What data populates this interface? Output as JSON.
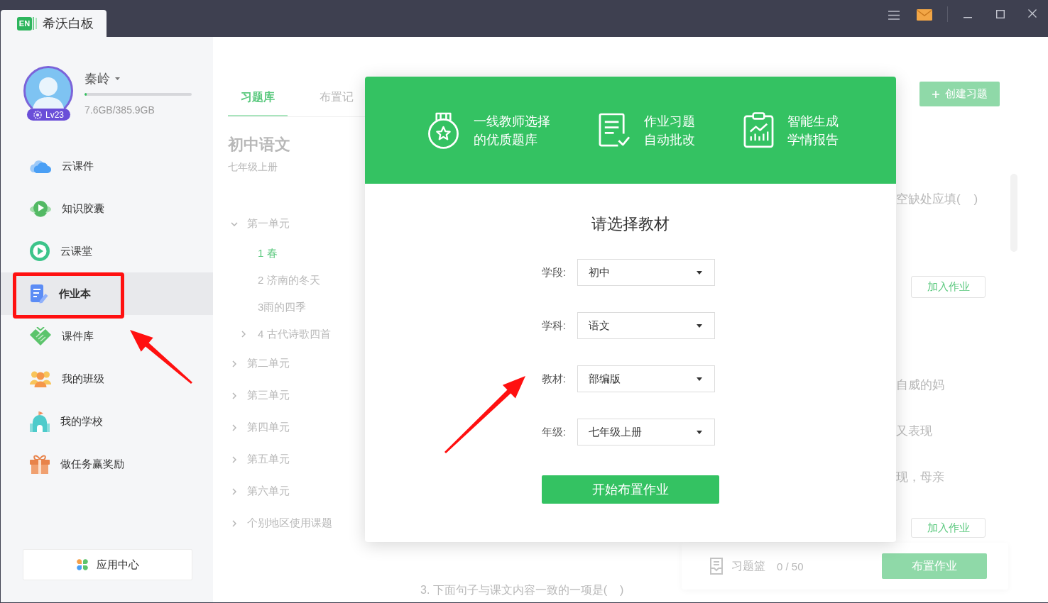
{
  "window": {
    "logo": "EN",
    "app_name": "希沃白板"
  },
  "user": {
    "name": "秦岭",
    "badge": "Lv23",
    "storage_bar": {
      "level": 0.02
    },
    "storage": "7.6GB/385.9GB"
  },
  "sidebar": {
    "items": [
      {
        "label": "云课件",
        "selected": false
      },
      {
        "label": "知识胶囊",
        "selected": false
      },
      {
        "label": "云课堂",
        "selected": false
      },
      {
        "label": "作业本",
        "selected": true
      },
      {
        "label": "课件库",
        "selected": false
      },
      {
        "label": "我的班级",
        "selected": false
      },
      {
        "label": "我的学校",
        "selected": false
      },
      {
        "label": "做任务赢奖励",
        "selected": false
      }
    ],
    "footer_button": "应用中心"
  },
  "library": {
    "tabs": [
      {
        "label": "习题库",
        "selected": true
      },
      {
        "label": "布置记",
        "selected": false
      }
    ],
    "book_title": "初中语文",
    "book_subtitle": "七年级上册",
    "tree": [
      {
        "label": "第一单元",
        "kind": "unit",
        "expanded": true,
        "selected": false,
        "children": [
          {
            "label": "1 春",
            "kind": "lesson",
            "selected": true
          },
          {
            "label": "2 济南的冬天",
            "kind": "lesson",
            "selected": false
          },
          {
            "label": "3雨的四季",
            "kind": "lesson",
            "selected": false
          },
          {
            "label": "4 古代诗歌四首",
            "kind": "lesson",
            "expanded": false,
            "selected": false
          }
        ]
      },
      {
        "label": "第二单元",
        "kind": "unit",
        "expanded": false,
        "selected": false
      },
      {
        "label": "第三单元",
        "kind": "unit",
        "expanded": false,
        "selected": false
      },
      {
        "label": "第四单元",
        "kind": "unit",
        "expanded": false,
        "selected": false
      },
      {
        "label": "第五单元",
        "kind": "unit",
        "expanded": false,
        "selected": false
      },
      {
        "label": "第六单元",
        "kind": "unit",
        "expanded": false,
        "selected": false
      },
      {
        "label": "个别地区使用课题",
        "kind": "unit",
        "expanded": false,
        "selected": false
      }
    ]
  },
  "exercises": {
    "create_button": "创建习题",
    "questions": [
      {
        "lines": [
          "空缺处应填(    )"
        ],
        "add_button": "加入作业"
      },
      {
        "lines": [
          "自威的妈",
          "又表现",
          "现，母亲"
        ],
        "add_button": "加入作业"
      }
    ],
    "next_question": "3. 下面句子与课文内容一致的一项是(    )"
  },
  "basket": {
    "label": "习题篮",
    "count": "0 / 50",
    "button": "布置作业"
  },
  "modal": {
    "features": [
      {
        "lines": [
          "一线教师选择",
          "的优质题库"
        ]
      },
      {
        "lines": [
          "作业习题",
          "自动批改"
        ]
      },
      {
        "lines": [
          "智能生成",
          "学情报告"
        ]
      }
    ],
    "title": "请选择教材",
    "fields": [
      {
        "label": "学段:",
        "value": "初中"
      },
      {
        "label": "学科:",
        "value": "语文"
      },
      {
        "label": "教材:",
        "value": "部编版"
      },
      {
        "label": "年级:",
        "value": "七年级上册"
      }
    ],
    "submit": "开始布置作业"
  }
}
